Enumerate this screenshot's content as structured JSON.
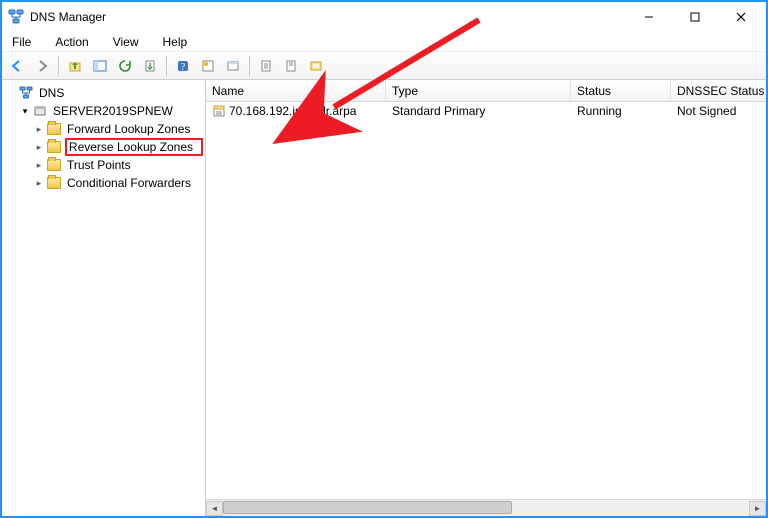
{
  "window": {
    "title": "DNS Manager"
  },
  "menu": {
    "file": "File",
    "action": "Action",
    "view": "View",
    "help": "Help"
  },
  "tree": {
    "root": "DNS",
    "server": "SERVER2019SPNEW",
    "nodes": {
      "forward": "Forward Lookup Zones",
      "reverse": "Reverse Lookup Zones",
      "trust": "Trust Points",
      "conditional": "Conditional Forwarders"
    }
  },
  "columns": {
    "name": "Name",
    "type": "Type",
    "status": "Status",
    "dnssec": "DNSSEC Status"
  },
  "rows": [
    {
      "name": "70.168.192.in-addr.arpa",
      "type": "Standard Primary",
      "status": "Running",
      "dnssec": "Not Signed"
    }
  ]
}
